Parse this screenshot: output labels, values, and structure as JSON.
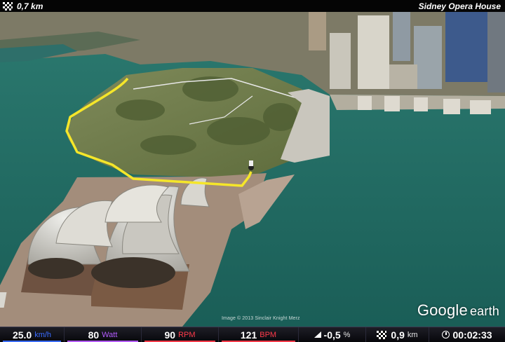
{
  "header": {
    "distance_label": "0,7 km",
    "location_title": "Sidney Opera House"
  },
  "map": {
    "logo_google": "Google",
    "logo_earth": "earth",
    "copyright": "Image © 2013 Sinclair Knight Merz"
  },
  "stats": {
    "speed": {
      "value": "25.0",
      "unit": "km/h",
      "color": "#3a6cff"
    },
    "power": {
      "value": "80",
      "unit": "Watt",
      "color": "#b45cff"
    },
    "cadence": {
      "value": "90",
      "unit": "RPM",
      "color": "#ff3a4a"
    },
    "heart_rate": {
      "value": "121",
      "unit": "BPM",
      "color": "#ff3a4a"
    },
    "grade": {
      "value": "-0,5",
      "unit": "%",
      "icon": "incline-icon"
    },
    "distance": {
      "value": "0,9",
      "unit": "km",
      "icon": "flag-icon"
    },
    "time": {
      "value": "00:02:33",
      "icon": "clock-icon"
    }
  },
  "colors": {
    "route": "#f5e62a",
    "water": "#1d6b63",
    "land": "#6e7c4a"
  }
}
